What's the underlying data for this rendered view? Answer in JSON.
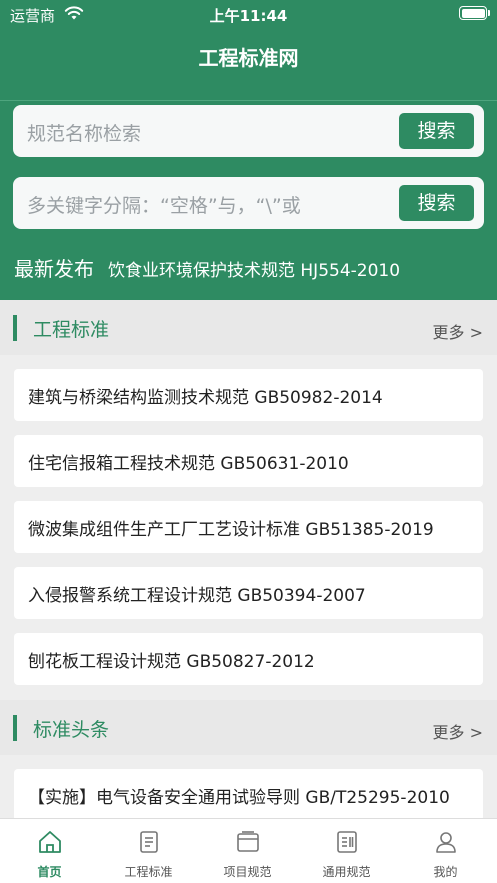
{
  "status_bar": {
    "carrier": "运营商",
    "time": "上午11:44"
  },
  "header": {
    "title": "工程标准网"
  },
  "search": {
    "placeholder_1": "规范名称检索",
    "button_1": "搜索",
    "placeholder_2": "多关键字分隔：“空格”与，“\\”或",
    "button_2": "搜索"
  },
  "latest": {
    "label": "最新发布",
    "item": "饮食业环境保护技术规范 HJ554-2010"
  },
  "sections": [
    {
      "title": "工程标准",
      "more": "更多 >",
      "items": [
        "建筑与桥梁结构监测技术规范 GB50982-2014",
        "住宅信报箱工程技术规范 GB50631-2010",
        "微波集成组件生产工厂工艺设计标准 GB51385-2019",
        "入侵报警系统工程设计规范 GB50394-2007",
        "刨花板工程设计规范 GB50827-2012"
      ]
    },
    {
      "title": "标准头条",
      "more": "更多 >",
      "items": [
        "【实施】电气设备安全通用试验导则 GB/T25295-2010"
      ]
    }
  ],
  "tabbar": [
    {
      "label": "首页",
      "icon": "home-icon",
      "active": true
    },
    {
      "label": "工程标准",
      "icon": "document-icon",
      "active": false
    },
    {
      "label": "项目规范",
      "icon": "folder-icon",
      "active": false
    },
    {
      "label": "通用规范",
      "icon": "book-icon",
      "active": false
    },
    {
      "label": "我的",
      "icon": "user-icon",
      "active": false
    }
  ],
  "colors": {
    "brand": "#2e8b62",
    "background": "#eeeeee"
  }
}
